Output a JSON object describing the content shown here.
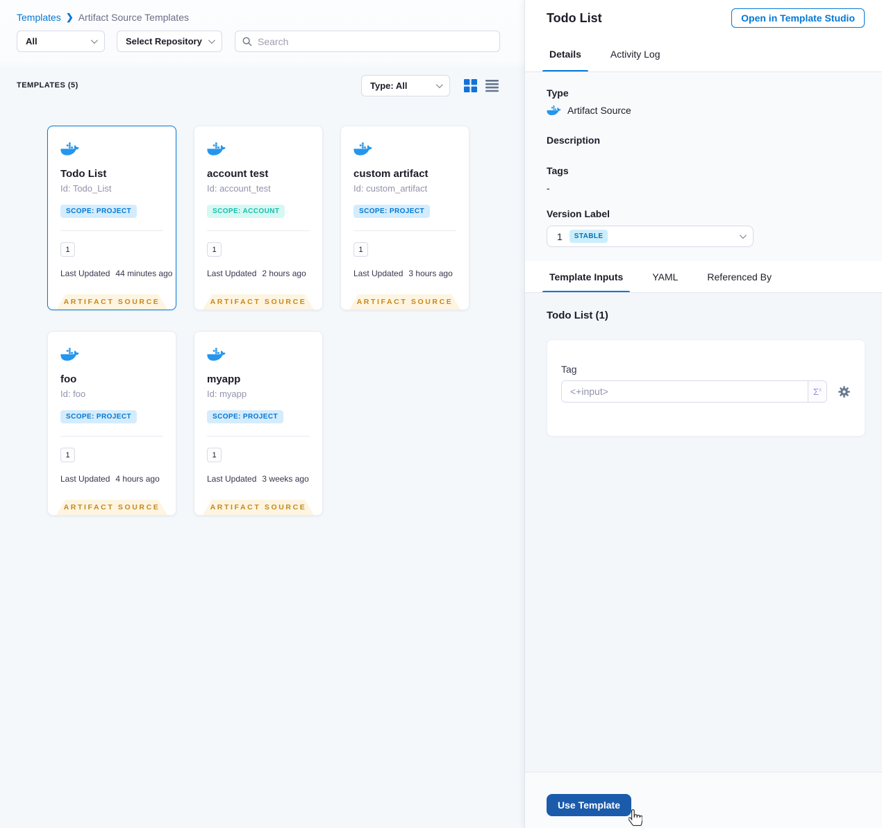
{
  "breadcrumb": {
    "root": "Templates",
    "separator": "❯",
    "current": "Artifact Source Templates"
  },
  "filters": {
    "type_filter": "All",
    "repository_filter": "Select Repository",
    "search_placeholder": "Search"
  },
  "list_header": {
    "count_label": "TEMPLATES (5)",
    "type_dropdown": "Type: All"
  },
  "cards": [
    {
      "title": "Todo List",
      "id": "Id: Todo_List",
      "scope": "SCOPE: PROJECT",
      "scope_type": "project",
      "version": "1",
      "updated_label": "Last Updated",
      "updated": "44 minutes ago",
      "footer": "ARTIFACT SOURCE"
    },
    {
      "title": "account test",
      "id": "Id: account_test",
      "scope": "SCOPE: ACCOUNT",
      "scope_type": "account",
      "version": "1",
      "updated_label": "Last Updated",
      "updated": "2 hours ago",
      "footer": "ARTIFACT SOURCE"
    },
    {
      "title": "custom artifact",
      "id": "Id: custom_artifact",
      "scope": "SCOPE: PROJECT",
      "scope_type": "project",
      "version": "1",
      "updated_label": "Last Updated",
      "updated": "3 hours ago",
      "footer": "ARTIFACT SOURCE"
    },
    {
      "title": "foo",
      "id": "Id: foo",
      "scope": "SCOPE: PROJECT",
      "scope_type": "project",
      "version": "1",
      "updated_label": "Last Updated",
      "updated": "4 hours ago",
      "footer": "ARTIFACT SOURCE"
    },
    {
      "title": "myapp",
      "id": "Id: myapp",
      "scope": "SCOPE: PROJECT",
      "scope_type": "project",
      "version": "1",
      "updated_label": "Last Updated",
      "updated": "3 weeks ago",
      "footer": "ARTIFACT SOURCE"
    }
  ],
  "details_panel": {
    "title": "Todo List",
    "open_studio_button": "Open in Template Studio",
    "tabs": {
      "details": "Details",
      "activity_log": "Activity Log"
    },
    "type_label": "Type",
    "type_value": "Artifact Source",
    "description_label": "Description",
    "tags_label": "Tags",
    "tags_value": "-",
    "version_label": "Version Label",
    "version_value": "1",
    "version_badge": "STABLE",
    "inputs_tabs": {
      "template_inputs": "Template Inputs",
      "yaml": "YAML",
      "referenced_by": "Referenced By"
    },
    "inputs_title": "Todo List (1)",
    "tag_label": "Tag",
    "tag_value": "<+input>",
    "expression_glyph": "Σ",
    "use_template_button": "Use Template"
  },
  "colors": {
    "accent_blue": "#0278d5",
    "docker_blue": "#2496ed",
    "scope_project_bg": "#d4ecfd",
    "scope_account_text": "#14c0ae",
    "ribbon_text": "#c8861d",
    "ribbon_bg": "#fdf5e1",
    "use_template_bg": "#1b5bab",
    "stable_badge_bg": "#cbeefd"
  }
}
